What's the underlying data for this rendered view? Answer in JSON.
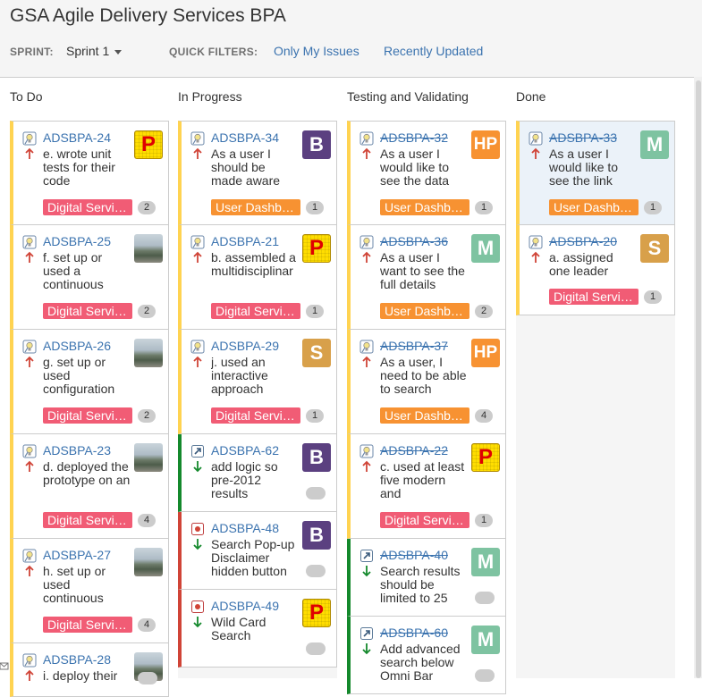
{
  "header": {
    "title": "GSA Agile Delivery Services BPA",
    "sprint_label": "SPRINT:",
    "sprint_value": "Sprint 1",
    "quick_filters_label": "QUICK FILTERS:",
    "quick_filters": [
      "Only My Issues",
      "Recently Updated"
    ]
  },
  "colors": {
    "todo_bar": "#ffd351",
    "done_bar": "#14892c",
    "bug_bar": "#d04437",
    "epic_digital": "#f15c75",
    "epic_user": "#f79232",
    "link": "#3b73af",
    "avatar_b": "#5b4080",
    "avatar_m": "#7ec3a1",
    "avatar_s": "#d8a04a",
    "avatar_hp": "#f79232"
  },
  "columns": [
    {
      "name": "To Do",
      "cards": [
        {
          "key": "ADSBPA-24",
          "summary": "e. wrote unit tests for their code",
          "type": "story-icon",
          "priority": "up-arrow-icon",
          "avatar": "P",
          "epic": "Digital Servi…",
          "estimate": "2"
        },
        {
          "key": "ADSBPA-25",
          "summary": "f. set up or used a continuous",
          "type": "story-icon",
          "priority": "up-arrow-icon",
          "avatar": "photo",
          "epic": "Digital Servi…",
          "estimate": "2"
        },
        {
          "key": "ADSBPA-26",
          "summary": "g. set up or used configuration",
          "type": "story-icon",
          "priority": "up-arrow-icon",
          "avatar": "photo",
          "epic": "Digital Servi…",
          "estimate": "2"
        },
        {
          "key": "ADSBPA-23",
          "summary": "d. deployed the prototype on an",
          "type": "story-icon",
          "priority": "up-arrow-icon",
          "avatar": "photo",
          "epic": "Digital Servi…",
          "estimate": "4"
        },
        {
          "key": "ADSBPA-27",
          "summary": "h. set up or used continuous",
          "type": "story-icon",
          "priority": "up-arrow-icon",
          "avatar": "photo",
          "epic": "Digital Servi…",
          "estimate": "4"
        },
        {
          "key": "ADSBPA-28",
          "summary": "i. deploy their",
          "type": "story-icon",
          "priority": "up-arrow-icon",
          "avatar": "photo",
          "epic": "",
          "estimate": ""
        }
      ]
    },
    {
      "name": "In Progress",
      "cards": [
        {
          "key": "ADSBPA-34",
          "summary": "As a user I should be made aware",
          "type": "story-icon",
          "priority": "up-arrow-icon",
          "avatar": "B",
          "epic": "User Dashb…",
          "estimate": "1"
        },
        {
          "key": "ADSBPA-21",
          "summary": "b. assembled a multidisciplinar",
          "type": "story-icon",
          "priority": "up-arrow-icon",
          "avatar": "P",
          "epic": "Digital Servi…",
          "estimate": "1"
        },
        {
          "key": "ADSBPA-29",
          "summary": "j. used an interactive approach",
          "type": "story-icon",
          "priority": "up-arrow-icon",
          "avatar": "S",
          "epic": "Digital Servi…",
          "estimate": "1"
        },
        {
          "key": "ADSBPA-62",
          "summary": "add logic so pre-2012 results",
          "type": "subtask-icon",
          "priority": "down-arrow-icon",
          "avatar": "B",
          "epic": "",
          "estimate": ""
        },
        {
          "key": "ADSBPA-48",
          "summary": "Search Pop-up Disclaimer hidden button",
          "type": "bug-icon",
          "priority": "down-arrow-icon",
          "avatar": "B",
          "epic": "",
          "estimate": ""
        },
        {
          "key": "ADSBPA-49",
          "summary": "Wild Card Search",
          "type": "bug-icon",
          "priority": "down-arrow-icon",
          "avatar": "P",
          "epic": "",
          "estimate": ""
        }
      ]
    },
    {
      "name": "Testing and Validating",
      "cards": [
        {
          "key": "ADSBPA-32",
          "summary": "As a user I would like to see the data",
          "type": "story-icon",
          "priority": "up-arrow-icon",
          "avatar": "HP",
          "epic": "User Dashb…",
          "estimate": "1"
        },
        {
          "key": "ADSBPA-36",
          "summary": "As a user I want to see the full details",
          "type": "story-icon",
          "priority": "up-arrow-icon",
          "avatar": "M",
          "epic": "User Dashb…",
          "estimate": "2"
        },
        {
          "key": "ADSBPA-37",
          "summary": "As a user, I need to be able to search",
          "type": "story-icon",
          "priority": "up-arrow-icon",
          "avatar": "HP",
          "epic": "User Dashb…",
          "estimate": "4"
        },
        {
          "key": "ADSBPA-22",
          "summary": "c. used at least five modern and",
          "type": "story-icon",
          "priority": "up-arrow-icon",
          "avatar": "P",
          "epic": "Digital Servi…",
          "estimate": "1"
        },
        {
          "key": "ADSBPA-40",
          "summary": "Search results should be limited to 25",
          "type": "subtask-icon",
          "priority": "down-arrow-icon",
          "avatar": "M",
          "epic": "",
          "estimate": ""
        },
        {
          "key": "ADSBPA-60",
          "summary": "Add advanced search below Omni Bar",
          "type": "subtask-icon",
          "priority": "down-arrow-icon",
          "avatar": "M",
          "epic": "",
          "estimate": ""
        }
      ]
    },
    {
      "name": "Done",
      "cards": [
        {
          "key": "ADSBPA-33",
          "summary": "As a user I would like to see the link",
          "type": "story-icon",
          "priority": "up-arrow-icon",
          "avatar": "M",
          "epic": "User Dashb…",
          "estimate": "1"
        },
        {
          "key": "ADSBPA-20",
          "summary": "a. assigned one leader",
          "type": "story-icon",
          "priority": "up-arrow-icon",
          "avatar": "S",
          "epic": "Digital Servi…",
          "estimate": "1"
        }
      ]
    }
  ]
}
